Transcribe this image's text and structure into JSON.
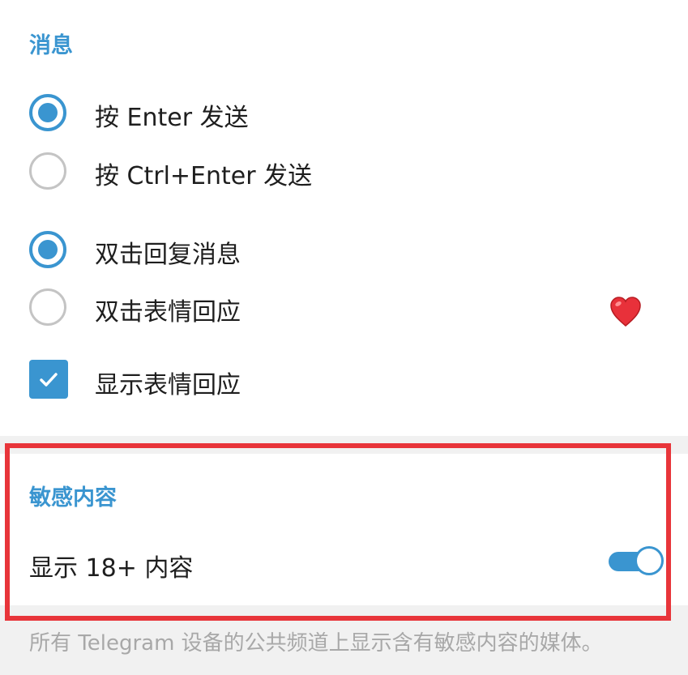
{
  "messages_section": {
    "title": "消息",
    "send_options": [
      {
        "label": "按 Enter 发送",
        "checked": true
      },
      {
        "label": "按 Ctrl+Enter 发送",
        "checked": false
      }
    ],
    "double_click_options": [
      {
        "label": "双击回复消息",
        "checked": true
      },
      {
        "label": "双击表情回应",
        "checked": false,
        "reaction_icon": "red-heart-icon"
      }
    ],
    "show_reactions": {
      "label": "显示表情回应",
      "checked": true
    }
  },
  "sensitive_section": {
    "title": "敏感内容",
    "show_18_plus": {
      "label": "显示 18+ 内容",
      "enabled": true
    },
    "description": "所有 Telegram 设备的公共频道上显示含有敏感内容的媒体。"
  },
  "colors": {
    "accent": "#3a95d0",
    "highlight_border": "#e8353a",
    "reaction_heart": "#e8313a"
  }
}
